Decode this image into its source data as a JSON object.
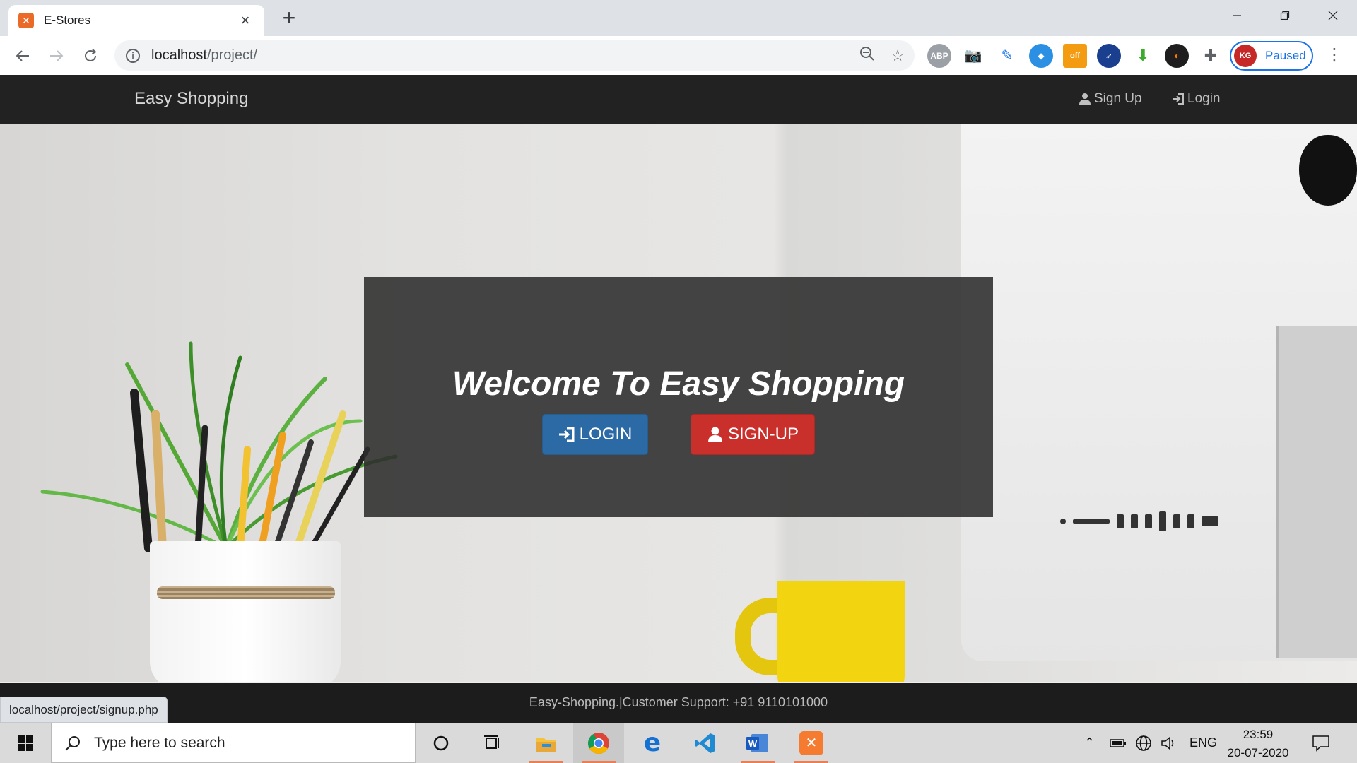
{
  "browser": {
    "tab_title": "E-Stores",
    "new_tab_symbol": "+",
    "url_host": "localhost",
    "url_path": "/project/",
    "profile_label": "Paused",
    "extensions": [
      "ABP",
      "off"
    ]
  },
  "site": {
    "brand": "Easy Shopping",
    "nav": {
      "signup_label": "Sign Up",
      "login_label": "Login"
    },
    "hero": {
      "title": "Welcome To Easy Shopping",
      "login_button": "LOGIN",
      "signup_button": "SIGN-UP"
    },
    "footer_text": "Easy-Shopping.|Customer Support: +91 9110101000",
    "status_url": "localhost/project/signup.php"
  },
  "taskbar": {
    "search_placeholder": "Type here to search",
    "language": "ENG",
    "time": "23:59",
    "date": "20-07-2020"
  },
  "colors": {
    "navbar": "#222222",
    "login_button": "#2c6aa5",
    "signup_button": "#c9302c",
    "welcome_panel": "#2c2c2c"
  }
}
